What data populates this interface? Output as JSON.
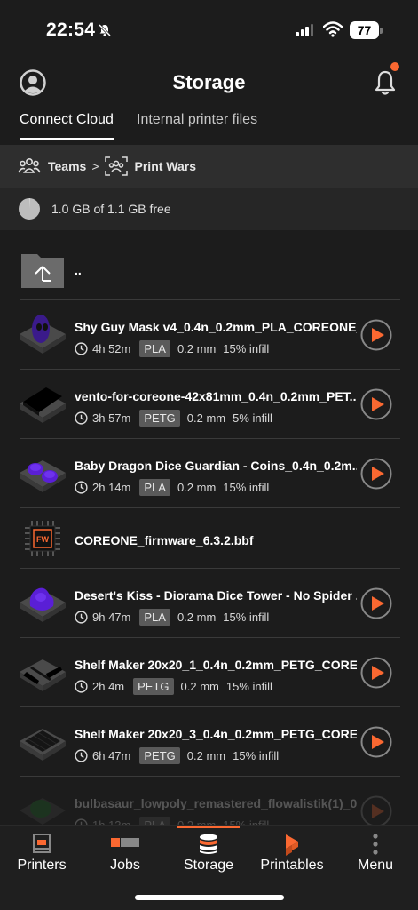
{
  "status_bar": {
    "time": "22:54",
    "battery": "77"
  },
  "header": {
    "title": "Storage"
  },
  "tabs": [
    {
      "label": "Connect Cloud",
      "active": true
    },
    {
      "label": "Internal printer files",
      "active": false
    }
  ],
  "breadcrumb": {
    "teams": "Teams",
    "printer": "Print Wars"
  },
  "storage": {
    "text": "1.0 GB of 1.1 GB free"
  },
  "files": [
    {
      "name": "..",
      "type": "folder-up"
    },
    {
      "name": "Shy Guy Mask v4_0.4n_0.2mm_PLA_COREONE_...",
      "time": "4h 52m",
      "material": "PLA",
      "layer": "0.2 mm",
      "infill": "15% infill"
    },
    {
      "name": "vento-for-coreone-42x81mm_0.4n_0.2mm_PET...",
      "time": "3h 57m",
      "material": "PETG",
      "layer": "0.2 mm",
      "infill": "5% infill"
    },
    {
      "name": "Baby Dragon Dice Guardian - Coins_0.4n_0.2m...",
      "time": "2h 14m",
      "material": "PLA",
      "layer": "0.2 mm",
      "infill": "15% infill"
    },
    {
      "name": "COREONE_firmware_6.3.2.bbf",
      "type": "firmware",
      "icon_label": "FW"
    },
    {
      "name": "Desert's Kiss - Diorama Dice Tower - No Spider ...",
      "time": "9h 47m",
      "material": "PLA",
      "layer": "0.2 mm",
      "infill": "15% infill"
    },
    {
      "name": "Shelf Maker 20x20_1_0.4n_0.2mm_PETG_CORE...",
      "time": "2h 4m",
      "material": "PETG",
      "layer": "0.2 mm",
      "infill": "15% infill"
    },
    {
      "name": "Shelf Maker 20x20_3_0.4n_0.2mm_PETG_CORE...",
      "time": "6h 47m",
      "material": "PETG",
      "layer": "0.2 mm",
      "infill": "15% infill"
    },
    {
      "name": "bulbasaur_lowpoly_remastered_flowalistik(1)_0....",
      "time": "1h 13m",
      "material": "PLA",
      "layer": "0.2 mm",
      "infill": "15% infill"
    }
  ],
  "bottom_nav": [
    {
      "label": "Printers",
      "icon": "printer-icon"
    },
    {
      "label": "Jobs",
      "icon": "jobs-icon"
    },
    {
      "label": "Storage",
      "icon": "storage-icon",
      "active": true
    },
    {
      "label": "Printables",
      "icon": "printables-icon"
    },
    {
      "label": "Menu",
      "icon": "menu-dots-icon"
    }
  ],
  "colors": {
    "accent": "#fa6831",
    "background": "#1c1c1c"
  }
}
